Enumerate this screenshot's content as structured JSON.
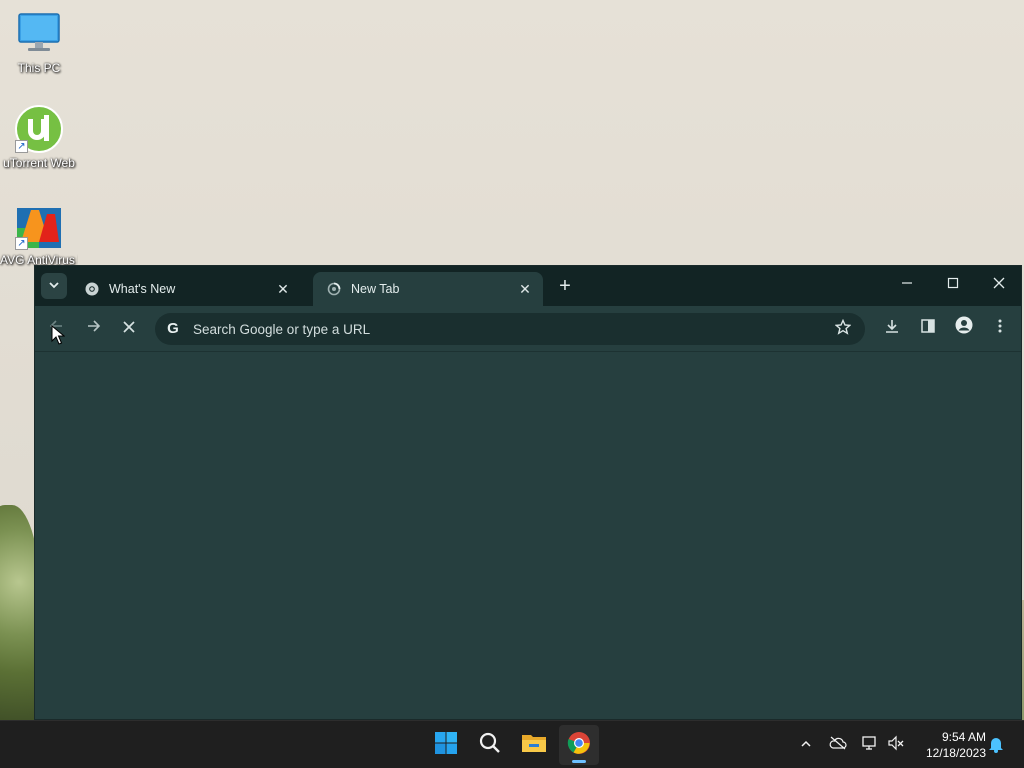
{
  "desktop": {
    "icons": [
      {
        "label": "This PC"
      },
      {
        "label": "uTorrent Web"
      },
      {
        "label": "AVG AntiVirus Free"
      }
    ]
  },
  "browser": {
    "tabs": [
      {
        "title": "What's New",
        "active": false
      },
      {
        "title": "New Tab",
        "active": true
      }
    ],
    "omnibox": {
      "placeholder": "Search Google or type a URL",
      "value": ""
    },
    "colors": {
      "frame": "#122424",
      "toolbar": "#263f3f",
      "omnibox": "#1a2f2f"
    }
  },
  "taskbar": {
    "clock": {
      "time": "9:54 AM",
      "date": "12/18/2023"
    },
    "pinned": [
      "start-icon",
      "search-icon",
      "file-explorer-icon",
      "chrome-icon"
    ]
  }
}
